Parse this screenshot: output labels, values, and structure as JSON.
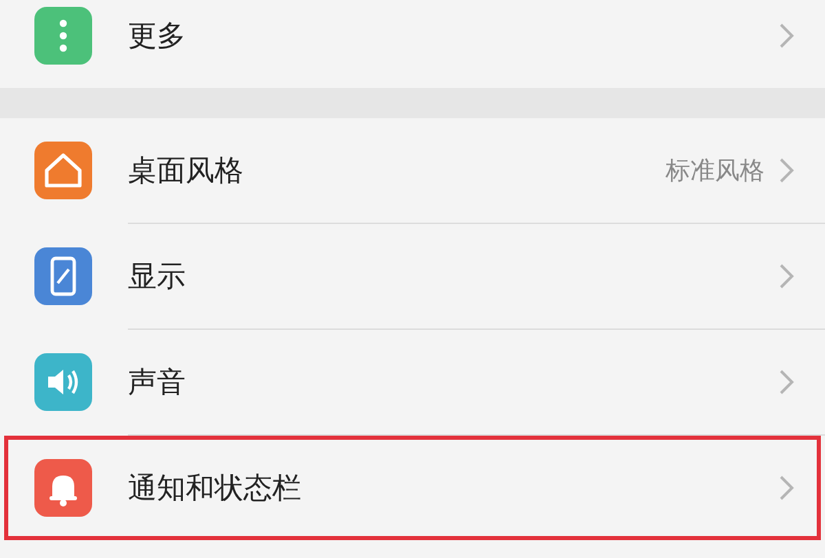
{
  "sections": [
    {
      "items": [
        {
          "kind": "more",
          "label": "更多",
          "highlighted": false
        }
      ]
    },
    {
      "items": [
        {
          "kind": "theme",
          "label": "桌面风格",
          "value": "标准风格",
          "highlighted": false
        },
        {
          "kind": "display",
          "label": "显示",
          "highlighted": false
        },
        {
          "kind": "sound",
          "label": "声音",
          "highlighted": false
        },
        {
          "kind": "notifications",
          "label": "通知和状态栏",
          "highlighted": true
        }
      ]
    }
  ]
}
